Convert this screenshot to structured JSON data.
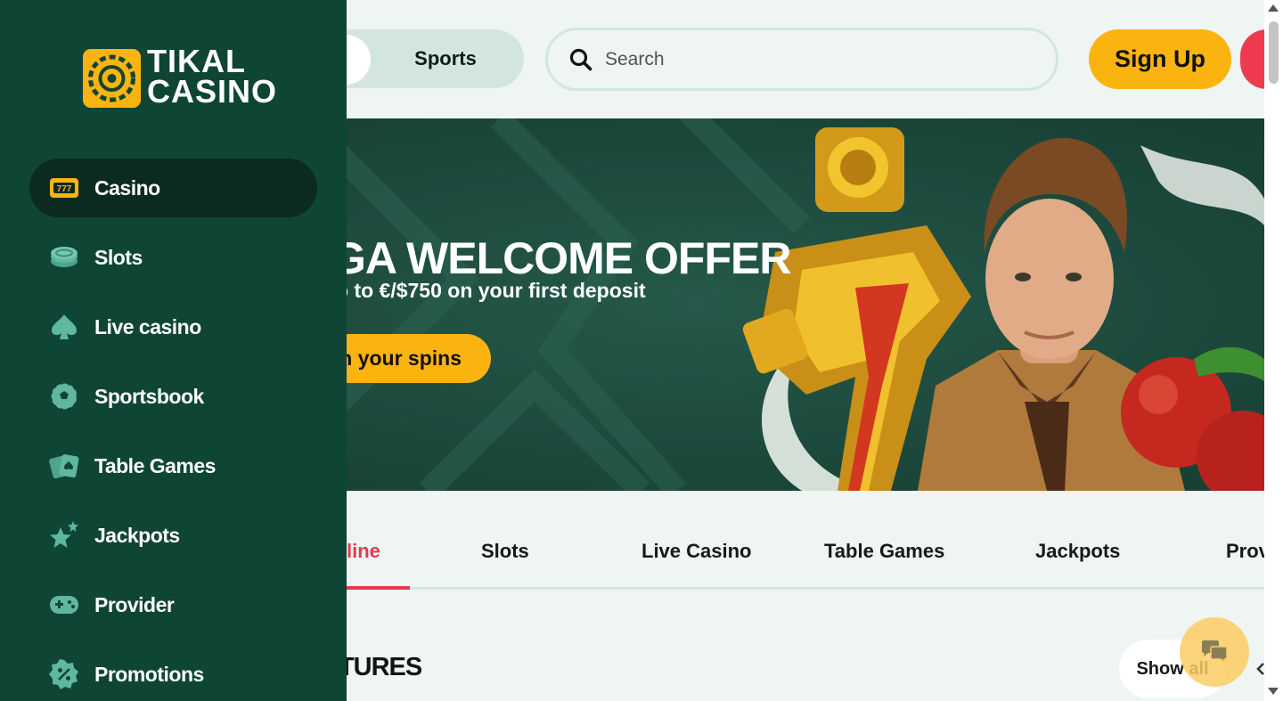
{
  "header": {
    "sports_label": "Sports",
    "search_placeholder": "Search",
    "signup_label": "Sign Up"
  },
  "banner": {
    "headline": "GA WELCOME OFFER",
    "subline": "o to €/$750 on your first deposit",
    "cta_label": "n your spins"
  },
  "tabs": {
    "items": [
      "line",
      "Slots",
      "Live Casino",
      "Table Games",
      "Jackpots",
      "Prov"
    ],
    "active_index": 0
  },
  "section": {
    "title": "NTURES",
    "show_all_label": "Show all"
  },
  "sidebar": {
    "logo": {
      "line1": "TIKAL",
      "line2": "CASINO"
    },
    "items": [
      {
        "label": "Casino",
        "icon": "slot-777-icon",
        "active": true
      },
      {
        "label": "Slots",
        "icon": "coins-icon"
      },
      {
        "label": "Live casino",
        "icon": "spade-icon"
      },
      {
        "label": "Sportsbook",
        "icon": "soccer-ball-icon"
      },
      {
        "label": "Table Games",
        "icon": "playing-cards-icon"
      },
      {
        "label": "Jackpots",
        "icon": "stars-icon"
      },
      {
        "label": "Provider",
        "icon": "gamepad-icon"
      },
      {
        "label": "Promotions",
        "icon": "percent-badge-icon"
      }
    ]
  },
  "colors": {
    "sidebar_bg": "#0f4534",
    "sidebar_active": "#0b2b21",
    "accent_yellow": "#fbb40f",
    "accent_red": "#e43a4f",
    "page_bg": "#eef5f2",
    "icon_teal": "#5fb7a0"
  }
}
